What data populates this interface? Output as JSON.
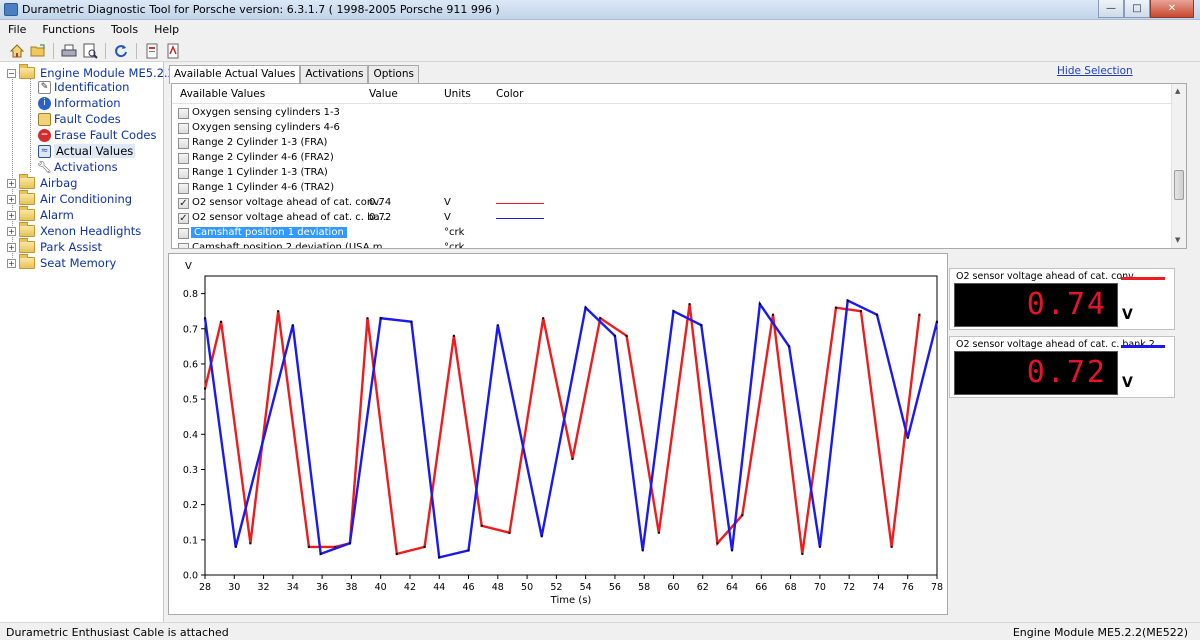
{
  "window": {
    "title": "Durametric Diagnostic Tool for Porsche version: 6.3.1.7  ( 1998-2005 Porsche 911 996 )",
    "minimize": "—",
    "maximize": "□",
    "close": "✕"
  },
  "menu": [
    "File",
    "Functions",
    "Tools",
    "Help"
  ],
  "toolbar": [
    "home-icon",
    "open-folder-icon",
    "print-icon",
    "print-preview-icon",
    "refresh-icon",
    "report-icon",
    "pdf-report-icon"
  ],
  "tree": {
    "engine": "Engine Module ME5.2.2",
    "children": [
      "Identification",
      "Information",
      "Fault Codes",
      "Erase Fault Codes",
      "Actual Values",
      "Activations"
    ],
    "modules": [
      "Airbag",
      "Air Conditioning",
      "Alarm",
      "Xenon Headlights",
      "Park Assist",
      "Seat Memory"
    ]
  },
  "tabs": [
    "Available Actual Values",
    "Activations",
    "Options"
  ],
  "hide_selection": "Hide Selection",
  "list": {
    "headers": {
      "name": "Available Values",
      "value": "Value",
      "units": "Units",
      "color": "Color"
    },
    "rows": [
      {
        "name": "Oxygen sensing  cylinders 1-3",
        "checked": false,
        "value": "",
        "unit": "",
        "color": ""
      },
      {
        "name": "Oxygen sensing  cylinders 4-6",
        "checked": false,
        "value": "",
        "unit": "",
        "color": ""
      },
      {
        "name": "Range 2 Cylinder 1-3 (FRA)",
        "checked": false,
        "value": "",
        "unit": "",
        "color": ""
      },
      {
        "name": "Range 2 Cylinder 4-6 (FRA2)",
        "checked": false,
        "value": "",
        "unit": "",
        "color": ""
      },
      {
        "name": "Range 1 Cylinder 1-3 (TRA)",
        "checked": false,
        "value": "",
        "unit": "",
        "color": ""
      },
      {
        "name": "Range 1 Cylinder 4-6 (TRA2)",
        "checked": false,
        "value": "",
        "unit": "",
        "color": ""
      },
      {
        "name": "O2 sensor voltage ahead of cat. conv.",
        "checked": true,
        "value": "0.74",
        "unit": "V",
        "color": "#ee1c1c"
      },
      {
        "name": "O2 sensor voltage ahead of cat. c.  ba...",
        "checked": true,
        "value": "0.72",
        "unit": "V",
        "color": "#1a1af0"
      },
      {
        "name": "Camshaft position 1 deviation",
        "checked": false,
        "value": "",
        "unit": "°crk",
        "color": "",
        "selected": true
      },
      {
        "name": "Camshaft position 2 deviation (USA m...",
        "checked": false,
        "value": "",
        "unit": "°crk",
        "color": ""
      }
    ]
  },
  "chart_data": {
    "type": "line",
    "ylabel": "V",
    "xlabel": "Time (s)",
    "xlim": [
      28,
      78
    ],
    "ylim": [
      0,
      0.85
    ],
    "xticks": [
      28,
      30,
      32,
      34,
      36,
      38,
      40,
      42,
      44,
      46,
      48,
      50,
      52,
      54,
      56,
      58,
      60,
      62,
      64,
      66,
      68,
      70,
      72,
      74,
      76,
      78
    ],
    "yticks": [
      0.0,
      0.1,
      0.2,
      0.3,
      0.4,
      0.5,
      0.6,
      0.7,
      0.8
    ],
    "ytick_labels": [
      "0.0",
      "0.1",
      "0.2",
      "0.3",
      "0.4",
      "0.5",
      "0.6",
      "0.7",
      "0.8"
    ],
    "grid": false,
    "series": [
      {
        "name": "O2 sensor voltage ahead of cat. conv.",
        "color": "#ee1c1c",
        "x": [
          28,
          29.1,
          31.1,
          33.0,
          35.1,
          36.9,
          37.9,
          39.1,
          41.1,
          43.0,
          45.0,
          46.9,
          48.8,
          51.1,
          53.1,
          55.0,
          56.8,
          59.0,
          61.1,
          63.0,
          64.7,
          66.8,
          68.8,
          71.1,
          72.8,
          74.9,
          76.8
        ],
        "values": [
          0.53,
          0.72,
          0.09,
          0.75,
          0.08,
          0.08,
          0.09,
          0.73,
          0.06,
          0.08,
          0.68,
          0.14,
          0.12,
          0.73,
          0.33,
          0.73,
          0.68,
          0.12,
          0.77,
          0.09,
          0.17,
          0.74,
          0.06,
          0.76,
          0.75,
          0.08,
          0.74
        ]
      },
      {
        "name": "O2 sensor voltage ahead of cat. c.  bank 2",
        "color": "#1a1af0",
        "x": [
          28,
          30.1,
          34.0,
          35.9,
          37.9,
          40.0,
          42.1,
          44.0,
          46.0,
          48.0,
          51.0,
          54.0,
          56.0,
          57.9,
          60.0,
          61.9,
          64.0,
          65.9,
          67.9,
          70.0,
          71.9,
          73.9,
          76.0,
          78.0
        ],
        "values": [
          0.73,
          0.08,
          0.71,
          0.06,
          0.09,
          0.73,
          0.72,
          0.05,
          0.07,
          0.71,
          0.11,
          0.76,
          0.68,
          0.07,
          0.75,
          0.71,
          0.07,
          0.77,
          0.65,
          0.08,
          0.78,
          0.74,
          0.39,
          0.72
        ]
      }
    ]
  },
  "gauges": [
    {
      "name": "O2 sensor voltage ahead of cat. conv.",
      "value": "0.74",
      "unit": "V",
      "color": "#ee1c1c"
    },
    {
      "name": "O2 sensor voltage ahead of cat. c.  bank 2",
      "value": "0.72",
      "unit": "V",
      "color": "#1a1af0"
    }
  ],
  "status": {
    "left": "Durametric Enthusiast Cable is attached",
    "right": "Engine Module ME5.2.2(ME522)"
  }
}
